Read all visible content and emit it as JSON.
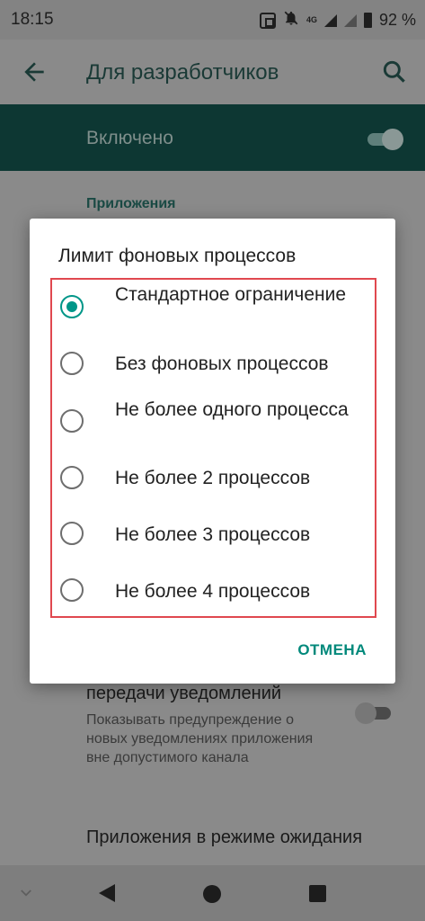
{
  "status_bar": {
    "time": "18:15",
    "network": "4G",
    "battery_pct": "92 %",
    "icons": [
      "nfc-icon",
      "bell-off-icon",
      "signal-icon",
      "signal-icon",
      "battery-icon"
    ]
  },
  "app_bar": {
    "title": "Для разработчиков",
    "back_icon": "arrow-back-icon",
    "search_icon": "search-icon"
  },
  "master_switch": {
    "label": "Включено",
    "state": "on"
  },
  "background_list": {
    "section_header": "Приложения",
    "item_title": "передачи уведомлений",
    "item_summary": "Показывать предупреждение о новых уведомлениях приложения вне допустимого канала",
    "item_switch_state": "off",
    "item_2_title": "Приложения в режиме ожидания"
  },
  "dialog": {
    "title": "Лимит фоновых процессов",
    "options": [
      {
        "label": "Стандартное ограничение",
        "checked": true
      },
      {
        "label": "Без фоновых процессов",
        "checked": false
      },
      {
        "label": "Не более одного процесса",
        "checked": false
      },
      {
        "label": "Не более 2 процессов",
        "checked": false
      },
      {
        "label": "Не более 3 процессов",
        "checked": false
      },
      {
        "label": "Не более 4 процессов",
        "checked": false
      }
    ],
    "cancel_label": "ОТМЕНА"
  },
  "colors": {
    "accent": "#009688",
    "highlight": "#e0484f",
    "master_bar": "#0d3733"
  },
  "nav_bar": {
    "icons": [
      "chevron-down-icon",
      "nav-back-icon",
      "nav-home-icon",
      "nav-recents-icon"
    ]
  }
}
